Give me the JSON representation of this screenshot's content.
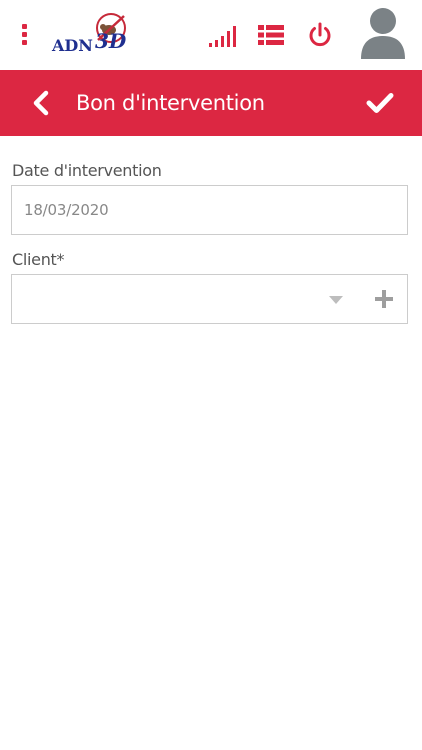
{
  "topbar": {
    "logo": {
      "text": "ADN",
      "number": "3D"
    }
  },
  "header": {
    "title": "Bon d'intervention"
  },
  "form": {
    "date": {
      "label": "Date d'intervention",
      "value": "18/03/2020"
    },
    "client": {
      "label": "Client*",
      "value": ""
    }
  },
  "colors": {
    "primary_red": "#dc2742",
    "avatar_gray": "#7b8286",
    "logo_blue": "#1f2f8f"
  },
  "icons": {
    "menu": "vertical-dots-icon",
    "signal": "signal-bars-icon",
    "list": "list-icon",
    "power": "power-icon",
    "avatar": "user-avatar-icon",
    "back": "chevron-left-icon",
    "confirm": "check-icon",
    "dropdown": "caret-down-icon",
    "add": "plus-icon"
  }
}
